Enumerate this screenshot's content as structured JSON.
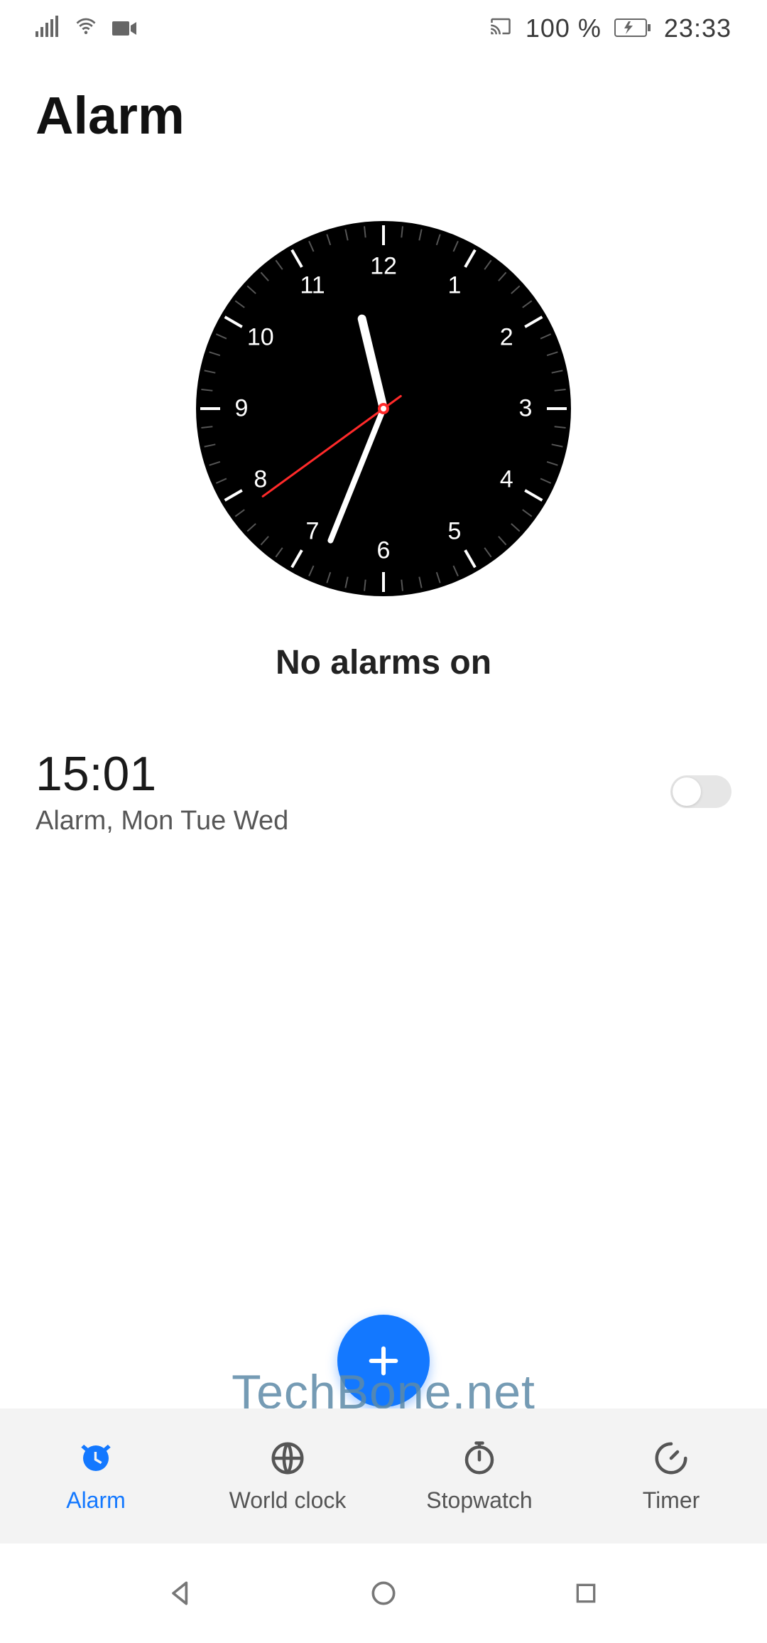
{
  "status": {
    "battery_pct": "100 %",
    "clock": "23:33"
  },
  "header": {
    "title": "Alarm"
  },
  "clock": {
    "status_text": "No alarms on",
    "numerals": [
      "12",
      "1",
      "2",
      "3",
      "4",
      "5",
      "6",
      "7",
      "8",
      "9",
      "10",
      "11"
    ],
    "hour": 11,
    "minute": 33,
    "second": 39
  },
  "alarms": [
    {
      "time": "15:01",
      "sub": "Alarm, Mon Tue Wed",
      "enabled": false
    }
  ],
  "fab": {
    "label": "Add alarm"
  },
  "watermark": "TechBone.net",
  "tabs": [
    {
      "icon": "alarm",
      "label": "Alarm",
      "active": true
    },
    {
      "icon": "globe",
      "label": "World clock",
      "active": false
    },
    {
      "icon": "stopwatch",
      "label": "Stopwatch",
      "active": false
    },
    {
      "icon": "timer",
      "label": "Timer",
      "active": false
    }
  ],
  "colors": {
    "accent": "#1378ff",
    "inactive": "#555555"
  }
}
